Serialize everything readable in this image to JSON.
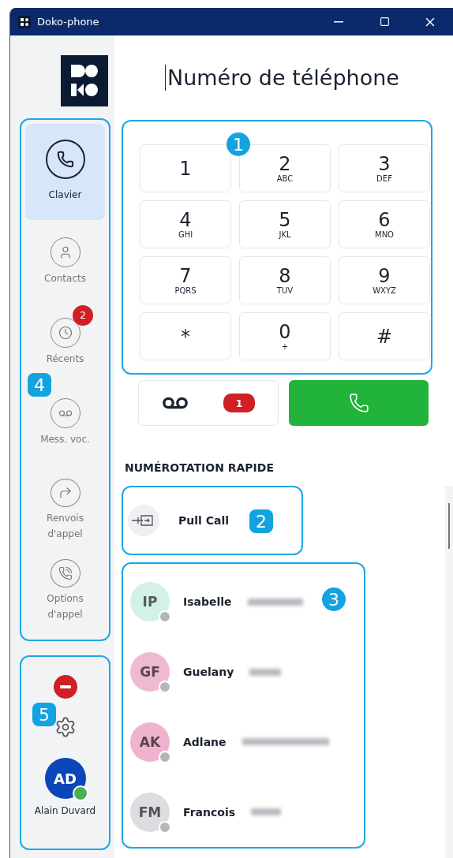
{
  "window": {
    "title": "Doko-phone"
  },
  "sidebar": {
    "items": [
      {
        "kind": "keypad",
        "label": "Clavier",
        "selected": true
      },
      {
        "kind": "contacts",
        "label": "Contacts",
        "selected": false
      },
      {
        "kind": "recents",
        "label": "Récents",
        "selected": false,
        "badge": "2"
      },
      {
        "kind": "voicemail",
        "label": "Mess. voc.",
        "selected": false
      },
      {
        "kind": "forward",
        "label": "Renvois d'appel",
        "selected": false
      },
      {
        "kind": "options",
        "label": "Options d'appel",
        "selected": false
      }
    ],
    "status": {
      "kind": "do-not-disturb"
    },
    "user": {
      "initials": "AD",
      "name": "Alain Duvard",
      "online": true,
      "color": "#0b46b8"
    }
  },
  "dialer": {
    "placeholder": "Numéro de téléphone",
    "keys": [
      {
        "digit": "1"
      },
      {
        "digit": "2",
        "letters": "ABC"
      },
      {
        "digit": "3",
        "letters": "DEF"
      },
      {
        "digit": "4",
        "letters": "GHI"
      },
      {
        "digit": "5",
        "letters": "JKL"
      },
      {
        "digit": "6",
        "letters": "MNO"
      },
      {
        "digit": "7",
        "letters": "PQRS"
      },
      {
        "digit": "8",
        "letters": "TUV"
      },
      {
        "digit": "9",
        "letters": "WXYZ"
      },
      {
        "digit": "*"
      },
      {
        "digit": "0",
        "letters": "+"
      },
      {
        "digit": "#"
      }
    ],
    "voicemail_count": "1"
  },
  "speed_dial": {
    "title": "NUMÉROTATION RAPIDE",
    "pull_call": {
      "label": "Pull Call"
    },
    "contacts": [
      {
        "initials": "IP",
        "name": "Isabelle",
        "color": "#d4f1e6",
        "online": false,
        "redacted": true
      },
      {
        "initials": "GF",
        "name": "Guelany",
        "color": "#f0b9d2",
        "online": false,
        "redacted": true
      },
      {
        "initials": "AK",
        "name": "Adlane",
        "color": "#efb3d0",
        "online": false,
        "redacted": true
      },
      {
        "initials": "FM",
        "name": "Francois",
        "color": "#dcdde0",
        "online": false,
        "redacted": true
      }
    ]
  },
  "callouts": [
    "1",
    "2",
    "3",
    "4",
    "5"
  ]
}
